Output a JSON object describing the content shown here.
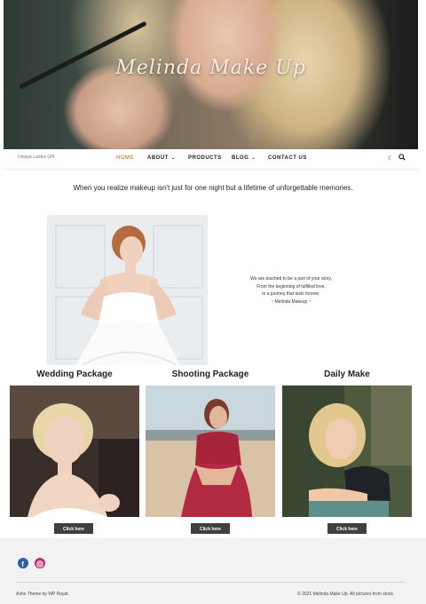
{
  "hero": {
    "title": "Melinda Make Up"
  },
  "header": {
    "tagline": "Unique Ladies Gift"
  },
  "nav": {
    "items": [
      {
        "label": "HOME"
      },
      {
        "label": "ABOUT"
      },
      {
        "label": "PRODUCTS"
      },
      {
        "label": "BLOG"
      },
      {
        "label": "CONTACT US"
      }
    ],
    "active_color": "#c79256",
    "icons": [
      "moon-icon",
      "search-icon",
      "chevron-down-icon"
    ]
  },
  "intro": {
    "quote": "When you realize makeup isn't just for one night but a lifetime of unforgettable memories."
  },
  "story": {
    "lines": [
      "We are touched to be a part of your story,",
      "From the beginning of fulfilled love,",
      "to a journey that lasts forever.",
      "~ Melinda Makeup ~"
    ]
  },
  "packages": [
    {
      "title": "Wedding Package",
      "button": "Click here"
    },
    {
      "title": "Shooting Package",
      "button": "Click here"
    },
    {
      "title": "Daily Make",
      "button": "Click here"
    }
  ],
  "footer": {
    "social": [
      "facebook-icon",
      "instagram-icon"
    ],
    "credit": "Ashe Theme by WP Royal.",
    "copyright": "© 2021 Melinda Make Up. All pictures from stock."
  }
}
